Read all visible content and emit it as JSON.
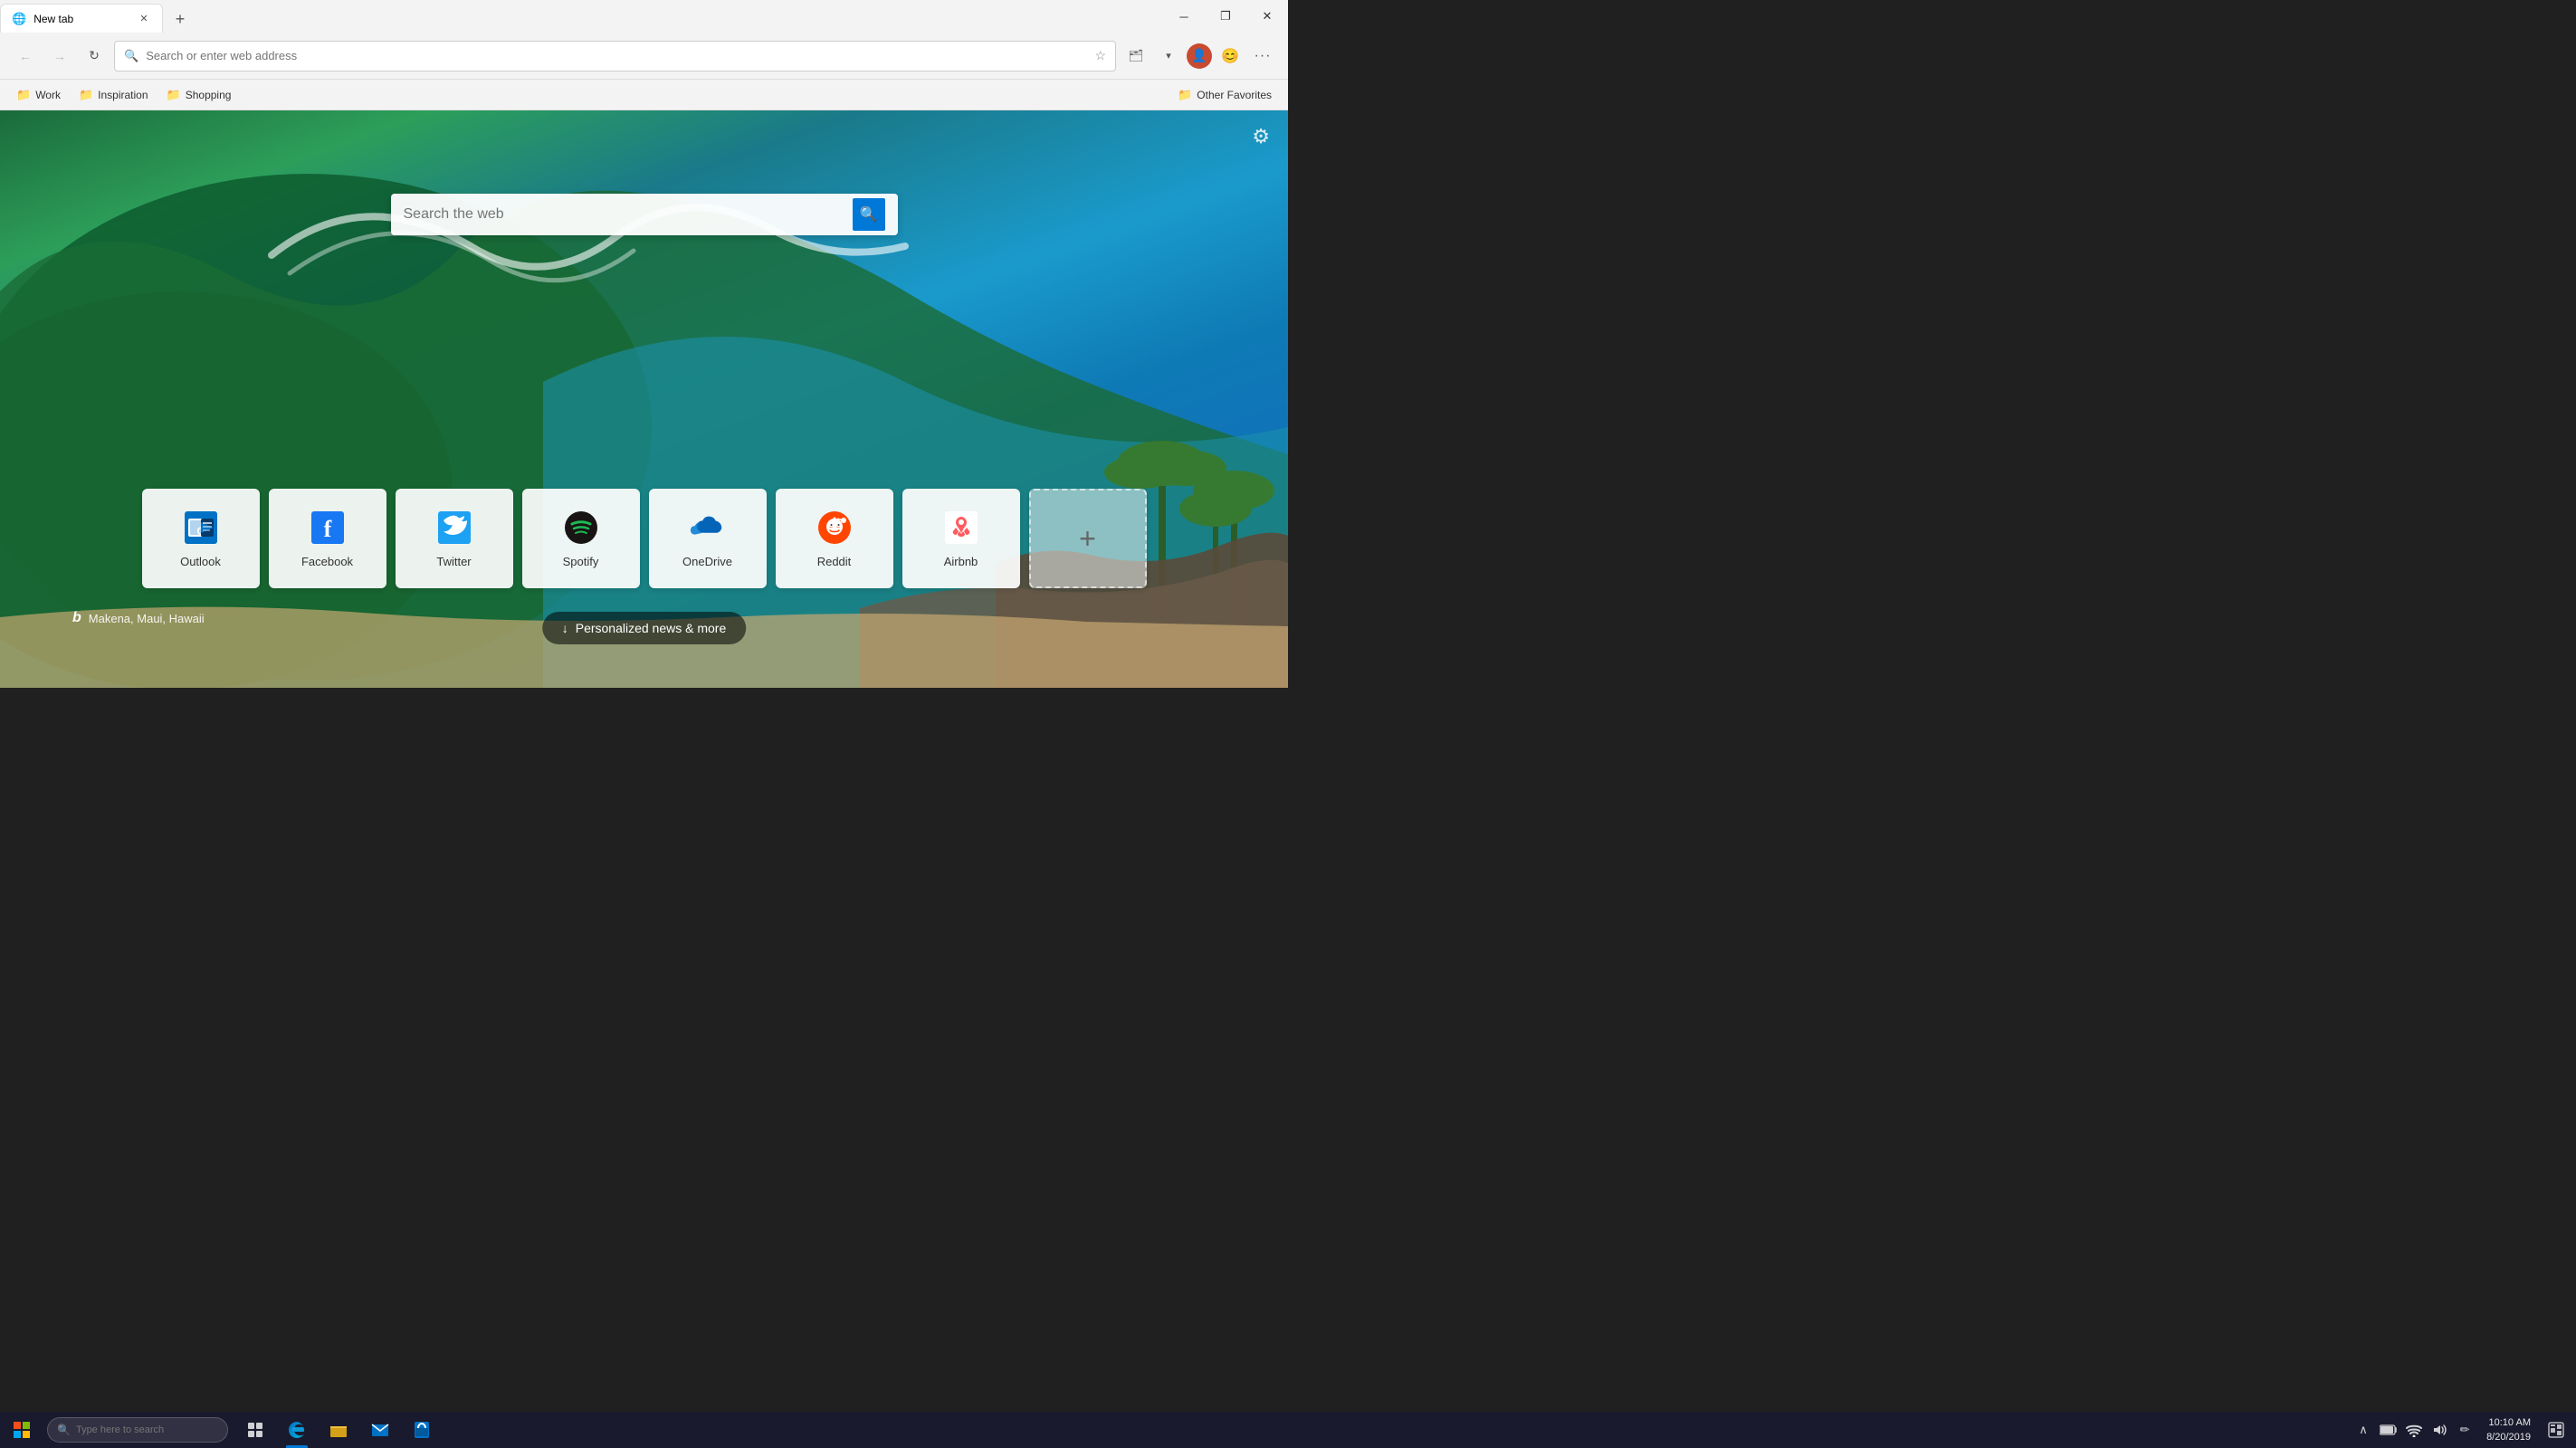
{
  "titlebar": {
    "tab_title": "New tab",
    "new_tab_tooltip": "New tab",
    "close": "✕",
    "minimize": "─",
    "maximize": "❐"
  },
  "toolbar": {
    "address_placeholder": "Search or enter web address",
    "back_label": "←",
    "forward_label": "→",
    "refresh_label": "↻"
  },
  "favorites": {
    "work_label": "Work",
    "inspiration_label": "Inspiration",
    "shopping_label": "Shopping",
    "other_label": "Other Favorites"
  },
  "search": {
    "placeholder": "Search the web"
  },
  "quicklinks": [
    {
      "id": "outlook",
      "label": "Outlook",
      "icon": "📧",
      "color": "#0072c6"
    },
    {
      "id": "facebook",
      "label": "Facebook",
      "icon": "f",
      "color": "#1877f2"
    },
    {
      "id": "twitter",
      "label": "Twitter",
      "icon": "🐦",
      "color": "#1da1f2"
    },
    {
      "id": "spotify",
      "label": "Spotify",
      "icon": "♫",
      "color": "#1db954"
    },
    {
      "id": "onedrive",
      "label": "OneDrive",
      "icon": "☁",
      "color": "#0364b8"
    },
    {
      "id": "reddit",
      "label": "Reddit",
      "icon": "👾",
      "color": "#ff4500"
    },
    {
      "id": "airbnb",
      "label": "Airbnb",
      "icon": "⌂",
      "color": "#ff5a5f"
    },
    {
      "id": "add",
      "label": "",
      "icon": "+",
      "color": "#888"
    }
  ],
  "attribution": {
    "bing_logo": "b",
    "location": "Makena, Maui, Hawaii"
  },
  "news_button": {
    "label": "Personalized news & more",
    "icon": "↓"
  },
  "taskbar": {
    "search_placeholder": "Type here to search",
    "time": "10:10 AM",
    "date": "8/20/2019",
    "start_icon": "⊞"
  }
}
